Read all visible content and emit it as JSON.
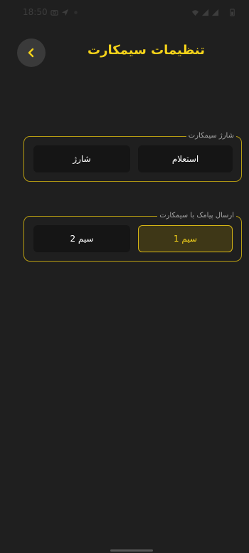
{
  "status_bar": {
    "time": "18:50"
  },
  "header": {
    "title": "تنظیمات سیمکارت"
  },
  "charge_group": {
    "legend": "شارژ سیمکارت",
    "left_button": "شارژ",
    "right_button": "استعلام"
  },
  "sms_group": {
    "legend": "ارسال پیامک با سیمکارت",
    "options": [
      {
        "label": "سیم 2",
        "selected": false
      },
      {
        "label": "سیم 1",
        "selected": true
      }
    ]
  },
  "colors": {
    "accent": "#f4d21a",
    "background": "#1f1f1f",
    "border": "#b79d12"
  }
}
